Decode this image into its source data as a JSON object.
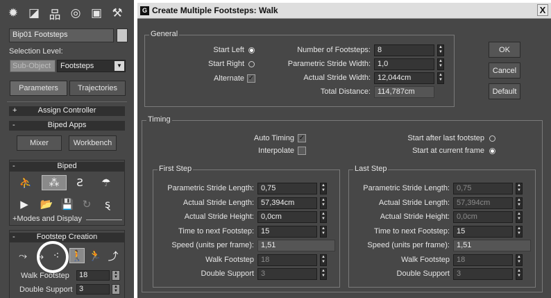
{
  "command_panel": {
    "tabs": [
      {
        "icon": "sun-icon",
        "glyph": "✹"
      },
      {
        "icon": "modify-icon",
        "glyph": "◪"
      },
      {
        "icon": "hierarchy-icon",
        "glyph": "品"
      },
      {
        "icon": "motion-icon",
        "glyph": "◎"
      },
      {
        "icon": "display-icon",
        "glyph": "▣"
      },
      {
        "icon": "utilities-icon",
        "glyph": "⚒"
      }
    ],
    "object_name": "Bip01 Footsteps",
    "swatch_color": "#c8c8c8",
    "selection_level_label": "Selection Level:",
    "sub_object_label": "Sub-Object",
    "sub_object_select": "Footsteps",
    "parameters_label": "Parameters",
    "trajectories_label": "Trajectories",
    "assign_controller": {
      "sign": "+",
      "title": "Assign Controller"
    },
    "biped_apps": {
      "sign": "-",
      "title": "Biped Apps",
      "mixer": "Mixer",
      "workbench": "Workbench"
    },
    "biped": {
      "sign": "-",
      "title": "Biped",
      "modes_display": "+Modes and Display"
    },
    "footstep_creation": {
      "sign": "-",
      "title": "Footstep Creation",
      "walk_footstep_label": "Walk Footstep",
      "walk_footstep_value": "18",
      "double_support_label": "Double Support",
      "double_support_value": "3"
    }
  },
  "dialog": {
    "title": "Create Multiple Footsteps: Walk",
    "close": "X",
    "general": {
      "title": "General",
      "start_left": "Start Left",
      "start_right": "Start Right",
      "alternate": "Alternate",
      "num_footsteps_label": "Number of Footsteps:",
      "num_footsteps": "8",
      "param_stride_width_label": "Parametric Stride Width:",
      "param_stride_width": "1,0",
      "actual_stride_width_label": "Actual Stride Width:",
      "actual_stride_width": "12,044cm",
      "total_distance_label": "Total Distance:",
      "total_distance": "114,787cm"
    },
    "buttons": {
      "ok": "OK",
      "cancel": "Cancel",
      "default": "Default"
    },
    "timing": {
      "title": "Timing",
      "auto_timing": "Auto Timing",
      "interpolate": "Interpolate",
      "start_after_last": "Start after last footstep",
      "start_at_current": "Start at current frame"
    },
    "first_step": {
      "title": "First Step",
      "rows": [
        {
          "label": "Parametric Stride Length:",
          "value": "0,75"
        },
        {
          "label": "Actual Stride Length:",
          "value": "57,394cm"
        },
        {
          "label": "Actual Stride Height:",
          "value": "0,0cm"
        },
        {
          "label": "Time to next Footstep:",
          "value": "15"
        },
        {
          "label": "Speed (units per frame):",
          "value": "1,51"
        },
        {
          "label": "Walk Footstep",
          "value": "18"
        },
        {
          "label": "Double Support",
          "value": "3"
        }
      ]
    },
    "last_step": {
      "title": "Last Step",
      "rows": [
        {
          "label": "Parametric Stride Length:",
          "value": "0,75"
        },
        {
          "label": "Actual Stride Length:",
          "value": "57,394cm"
        },
        {
          "label": "Actual Stride Height:",
          "value": "0,0cm"
        },
        {
          "label": "Time to next Footstep:",
          "value": "15"
        },
        {
          "label": "Speed (units per frame):",
          "value": "1,51"
        },
        {
          "label": "Walk Footstep",
          "value": "18"
        },
        {
          "label": "Double Support",
          "value": "3"
        }
      ]
    }
  }
}
